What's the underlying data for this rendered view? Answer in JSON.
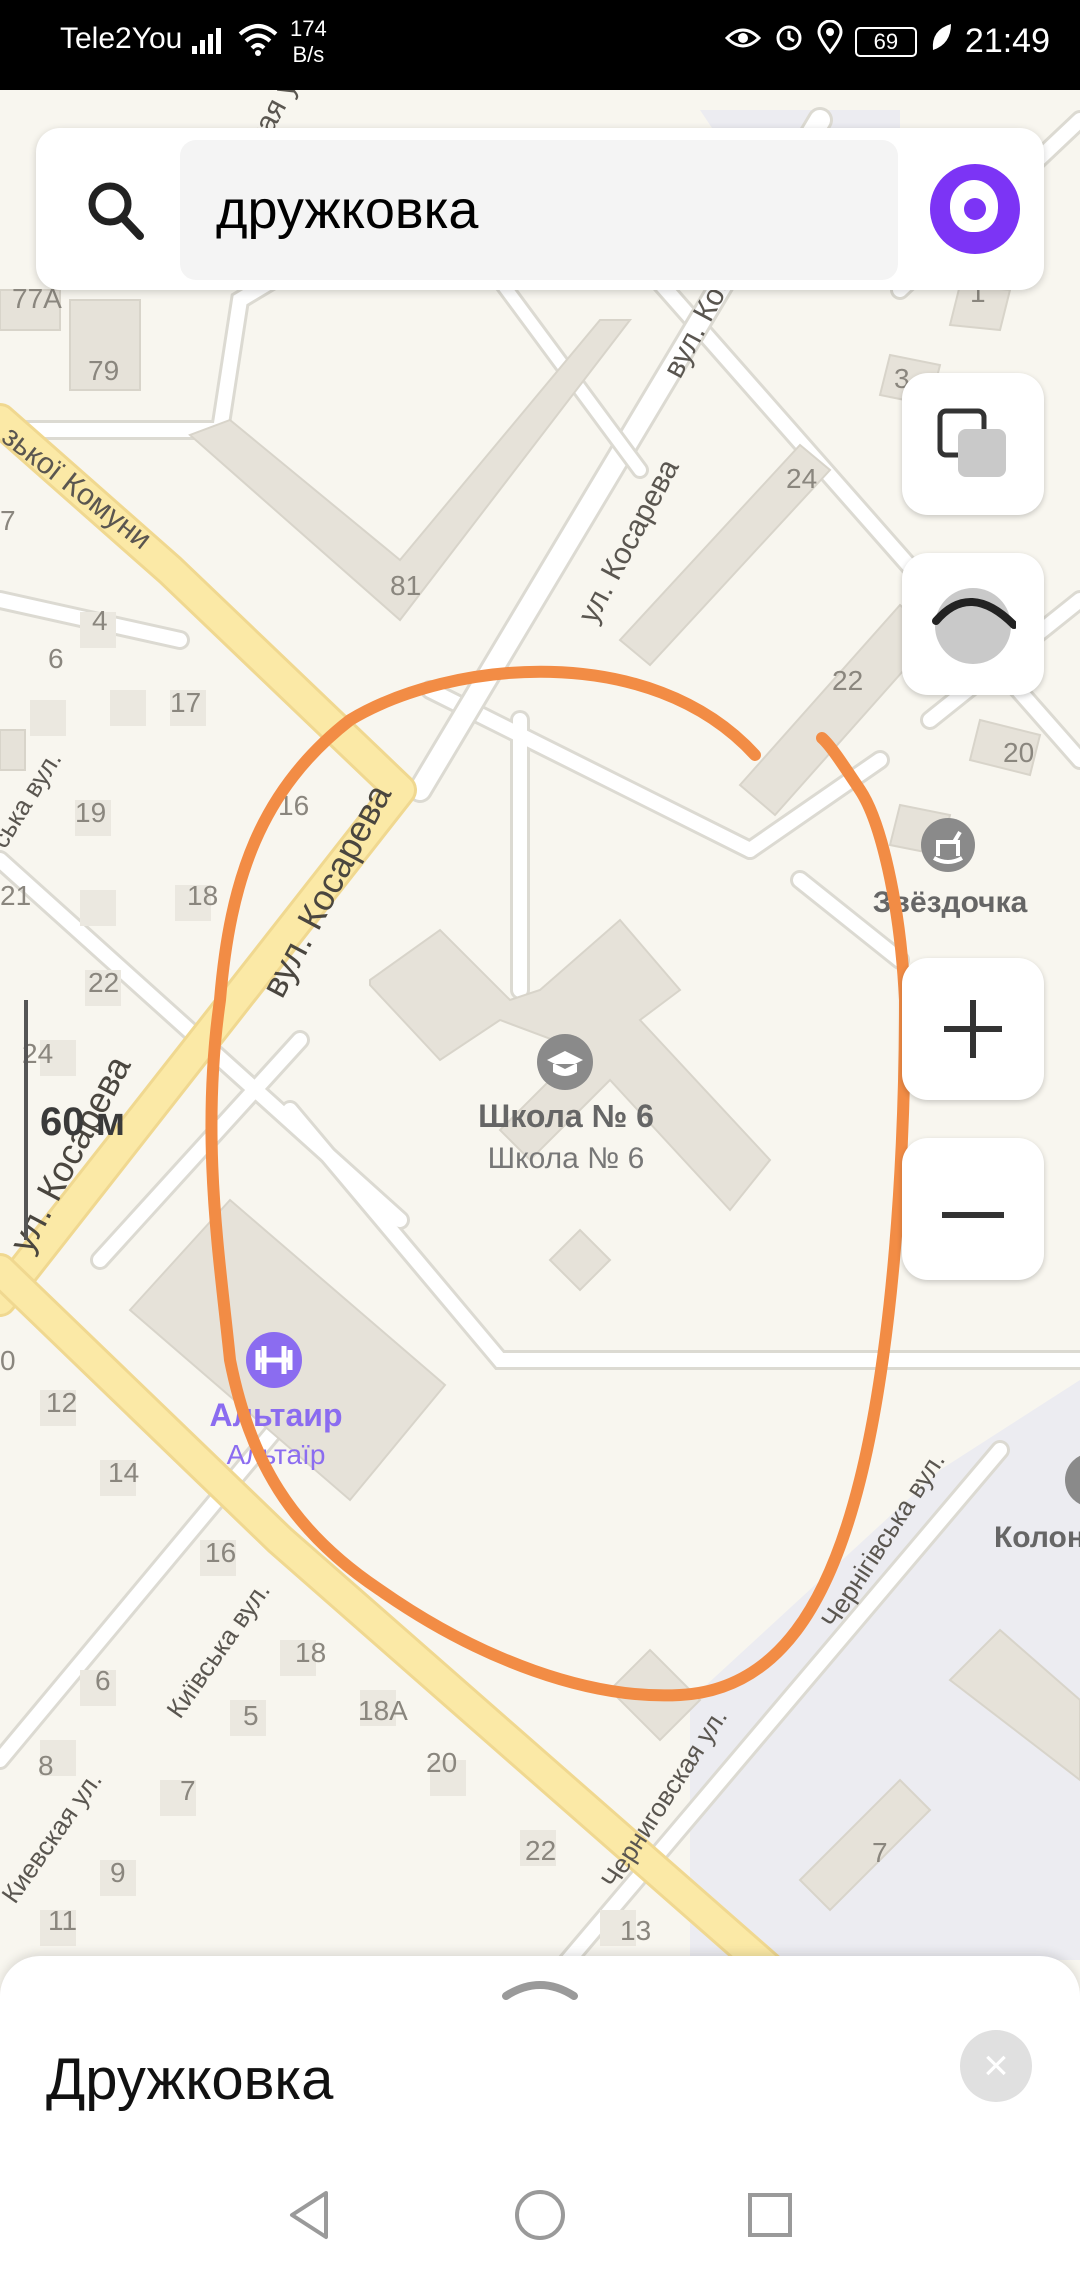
{
  "status_bar": {
    "carrier": "Tele2You",
    "net_speed_value": "174",
    "net_speed_unit": "B/s",
    "battery": "69",
    "time": "21:49"
  },
  "search": {
    "query": "дружковка",
    "placeholder": ""
  },
  "map": {
    "scale_label": "60 м",
    "streets": {
      "kosareva_ua_top": "вул. Косарева",
      "kosareva_ru_mid": "ул. Косарева",
      "kosareva_ua_left": "вул. Косарева",
      "kosareva_ru_left": "ул. Косарева",
      "komuny": "зької Комуни",
      "kyivska_ua": "Київська вул.",
      "kievskaya_ru": "Киевская ул.",
      "chernihivska_ua": "Чернігівська вул.",
      "chernigovskaya_ru": "Черниговская ул.",
      "skavul": "ська вул.",
      "top_cut": "ская ул."
    },
    "house_numbers": {
      "h77a": "77А",
      "h79": "79",
      "h81": "81",
      "h24a": "24",
      "h22a": "22",
      "h20": "20",
      "h1": "1",
      "h3": "3",
      "h7a": "7",
      "h4": "4",
      "h6a": "6",
      "h17": "17",
      "h19": "19",
      "h16": "16",
      "h18a": "18",
      "h21": "21",
      "h22b": "22",
      "h24b": "24",
      "h0": "0",
      "h12": "12",
      "h14": "14",
      "h16b": "16",
      "h6b": "6",
      "h8": "8",
      "h5": "5",
      "h7b": "7",
      "h9": "9",
      "h11": "11",
      "h18b": "18",
      "h18c": "18А",
      "h20b": "20",
      "h22c": "22",
      "h13": "13",
      "h7c": "7"
    },
    "pois": {
      "school_name_ru": "Школа № 6",
      "school_name_ua": "Школа № 6",
      "altair_ru": "Альтаир",
      "altair_ua": "Альтаїр",
      "zvezdochka": "Звёздочка",
      "kolon": "Колон"
    },
    "colors": {
      "background": "#f8f6ef",
      "building": "#e6e2d9",
      "main_road": "#fbe9a6",
      "annotation": "#f28c45",
      "poi_fitness": "#8b6cf0"
    }
  },
  "bottom_sheet": {
    "title": "Дружковка"
  },
  "icons": {
    "search": "search-icon",
    "assistant": "alice-icon",
    "layers": "layers-icon",
    "compass": "compass-icon",
    "zoom_in": "plus-icon",
    "zoom_out": "minus-icon",
    "close": "close-icon",
    "back": "back-triangle-icon",
    "home": "home-circle-icon",
    "recents": "recents-square-icon"
  }
}
